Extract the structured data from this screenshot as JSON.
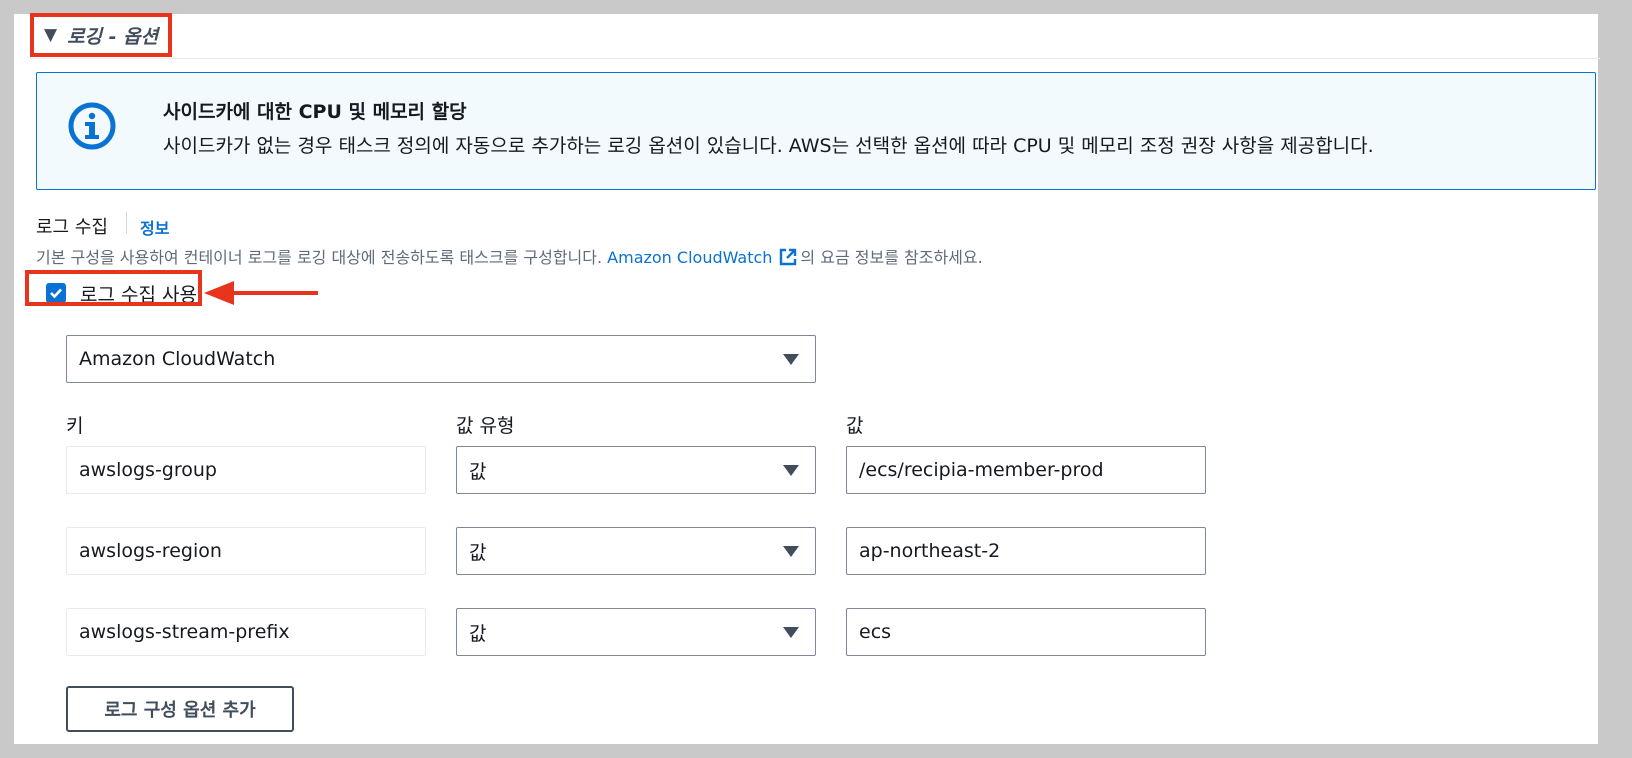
{
  "section": {
    "title": "로깅 - 옵션"
  },
  "alert": {
    "title": "사이드카에 대한 CPU 및 메모리 할당",
    "body": "사이드카가 없는 경우 태스크 정의에 자동으로 추가하는 로깅 옵션이 있습니다. AWS는 선택한 옵션에 따라 CPU 및 메모리 조정 권장 사항을 제공합니다."
  },
  "log_collection": {
    "label": "로그 수집",
    "info_link": "정보",
    "description_prefix": "기본 구성을 사용하여 컨테이너 로그를 로깅 대상에 전송하도록 태스크를 구성합니다. ",
    "description_link": "Amazon CloudWatch",
    "description_suffix": "의 요금 정보를 참조하세요.",
    "checkbox_label": "로그 수집 사용",
    "checked": true,
    "destination": "Amazon CloudWatch"
  },
  "options_table": {
    "headers": {
      "key": "키",
      "value_type": "값 유형",
      "value": "값"
    },
    "rows": [
      {
        "key": "awslogs-group",
        "value_type": "값",
        "value": "/ecs/recipia-member-prod"
      },
      {
        "key": "awslogs-region",
        "value_type": "값",
        "value": "ap-northeast-2"
      },
      {
        "key": "awslogs-stream-prefix",
        "value_type": "값",
        "value": "ecs"
      }
    ]
  },
  "add_button_label": "로그 구성 옵션 추가",
  "colors": {
    "accent": "#0972d3",
    "annotation_red": "#e8341c",
    "alert_bg": "#f2fafe"
  }
}
